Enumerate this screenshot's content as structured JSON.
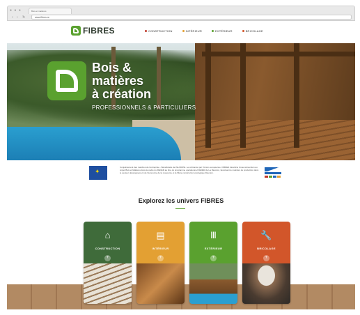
{
  "browser": {
    "tab_title": "Bois et matières",
    "url": "www.fibres.re",
    "window_controls": "● ● ●"
  },
  "header": {
    "logo_text": "FIBRES",
    "nav": [
      {
        "label": "CONSTRUCTION",
        "color": "#c0392b"
      },
      {
        "label": "INTÉRIEUR",
        "color": "#e3a033"
      },
      {
        "label": "EXTÉRIEUR",
        "color": "#5aa12f"
      },
      {
        "label": "BRICOLAGE",
        "color": "#d2562a"
      }
    ]
  },
  "hero": {
    "title_lines": [
      "Bois &",
      "matières",
      "à création"
    ],
    "subtitle": "PROFESSIONNELS & PARTICULIERS"
  },
  "eu": {
    "text": "Conjointement des marches de l'entreprise - Bénéficiaire de l'EUROPE. Le cofinancé par l'Union européenne. FIBRES bénéficie d'une subvention au projet Bois et Matières dans le cadre du FEDER au titre du programme opérationnel FEDER de La Réunion, favorisant le maintien de production dans le secteur développement de l'économie de la ressource et la filière construction écologique Réunion."
  },
  "explore": {
    "title": "Explorez les univers FIBRES"
  },
  "cards": [
    {
      "label": "CONSTRUCTION",
      "color": "#3f6b3a",
      "icon": "house-icon",
      "glyph": "⌂",
      "plus": "+"
    },
    {
      "label": "INTÉRIEUR",
      "color": "#e3a033",
      "icon": "interior-icon",
      "glyph": "▤",
      "plus": "+"
    },
    {
      "label": "EXTÉRIEUR",
      "color": "#5aa12f",
      "icon": "fence-icon",
      "glyph": "Ⅲ",
      "plus": "+"
    },
    {
      "label": "BRICOLAGE",
      "color": "#d2562a",
      "icon": "wrench-icon",
      "glyph": "🔧",
      "plus": "+"
    }
  ]
}
